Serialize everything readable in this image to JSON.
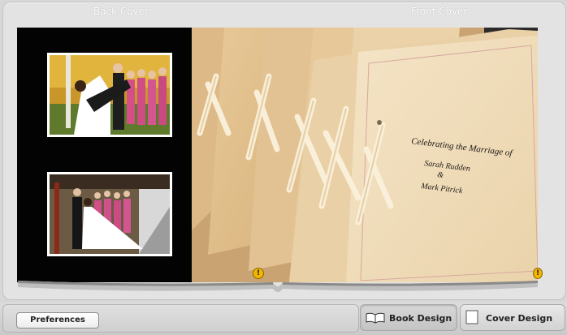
{
  "cover_labels": {
    "back": "Back Cover",
    "front": "Front Cover"
  },
  "front_cover_text": {
    "line1": "Celebrating the Marriage of",
    "line2": "Sarah Rudden",
    "line3": "&",
    "line4": "Mark Pitrick"
  },
  "warnings": {
    "symbol": "!"
  },
  "toolbar": {
    "preferences_label": "Preferences",
    "book_design_label": "Book Design",
    "cover_design_label": "Cover Design"
  },
  "icons": {
    "book_tab": "open-book-icon",
    "cover_tab": "cover-page-icon",
    "warning": "warning-icon"
  },
  "colors": {
    "back_cover": "#030303",
    "warning": "#f3b600",
    "paper": "#f0d9b0"
  }
}
